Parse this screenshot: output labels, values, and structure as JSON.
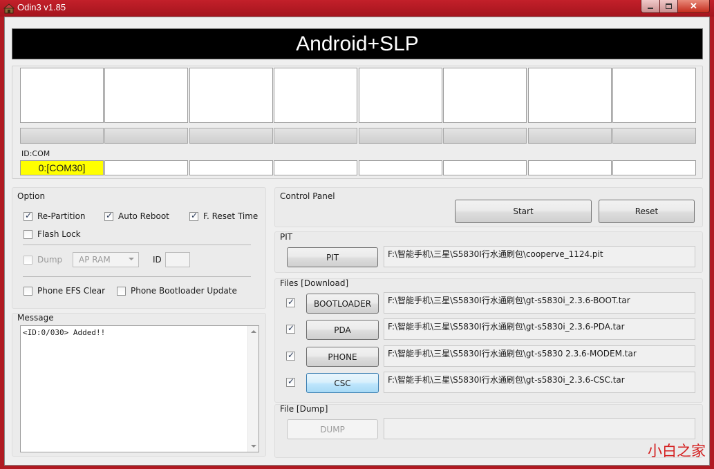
{
  "window": {
    "title": "Odin3 v1.85"
  },
  "banner": {
    "text": "Android+SLP"
  },
  "slots": {
    "id_com_label": "ID:COM",
    "com_values": [
      "0:[COM30]",
      "",
      "",
      "",
      "",
      "",
      "",
      ""
    ]
  },
  "option": {
    "title": "Option",
    "re_partition": "Re-Partition",
    "auto_reboot": "Auto Reboot",
    "f_reset_time": "F. Reset Time",
    "flash_lock": "Flash Lock",
    "dump": "Dump",
    "dump_select": "AP RAM",
    "id_label": "ID",
    "phone_efs_clear": "Phone EFS Clear",
    "phone_bootloader_update": "Phone Bootloader Update"
  },
  "message": {
    "title": "Message",
    "log": "<ID:0/030> Added!!"
  },
  "control_panel": {
    "title": "Control Panel",
    "start": "Start",
    "reset": "Reset"
  },
  "pit": {
    "title": "PIT",
    "button": "PIT",
    "path": "F:\\智能手机\\三星\\S5830I行水通刷包\\cooperve_1124.pit"
  },
  "files": {
    "title": "Files [Download]",
    "bootloader": {
      "button": "BOOTLOADER",
      "path": "F:\\智能手机\\三星\\S5830I行水通刷包\\gt-s5830i_2.3.6-BOOT.tar"
    },
    "pda": {
      "button": "PDA",
      "path": "F:\\智能手机\\三星\\S5830I行水通刷包\\gt-s5830i_2.3.6-PDA.tar"
    },
    "phone": {
      "button": "PHONE",
      "path": "F:\\智能手机\\三星\\S5830I行水通刷包\\gt-s5830 2.3.6-MODEM.tar"
    },
    "csc": {
      "button": "CSC",
      "path": "F:\\智能手机\\三星\\S5830I行水通刷包\\gt-s5830i_2.3.6-CSC.tar"
    }
  },
  "file_dump": {
    "title": "File [Dump]",
    "button": "DUMP"
  },
  "watermark": "小白之家",
  "colors": {
    "title_bar": "#b01a22",
    "active_com": "#ffff00",
    "watermark": "#d41e1e"
  }
}
